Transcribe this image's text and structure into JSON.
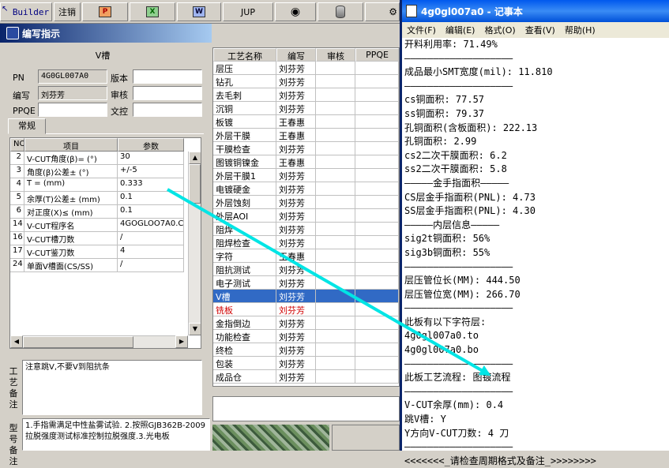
{
  "toolbar": {
    "builder_label": "Builder",
    "logout_label": "注销",
    "jup_label": "JUP",
    "ppt_icon": "P",
    "excel_icon": "X",
    "word_icon": "W"
  },
  "window": {
    "title": "编写指示"
  },
  "header": {
    "section_title": "V槽",
    "pn_label": "PN",
    "pn_value": "4G0GL007A0",
    "version_label": "版本",
    "version_value": "",
    "author_label": "编写",
    "author_value": "刘芬芳",
    "review_label": "审核",
    "review_value": "",
    "ppqe_label": "PPQE",
    "ppqe_value": "",
    "control_label": "文控",
    "control_value": ""
  },
  "tab": {
    "label": "常规"
  },
  "param_grid": {
    "headers": [
      "NO",
      "项目",
      "参数"
    ],
    "rows": [
      [
        "2",
        "V-CUT角度(β)= (°)",
        "30"
      ],
      [
        "3",
        "角度(β)公差± (°)",
        "+/-5"
      ],
      [
        "4",
        "T =  (mm)",
        "0.333"
      ],
      [
        "5",
        "余厚(T)公差± (mm)",
        "0.1"
      ],
      [
        "6",
        "对正度(X)≤ (mm)",
        "0.1"
      ],
      [
        "14",
        "V-CUT程序名",
        "4GOGLOO7A0.CS"
      ],
      [
        "16",
        "V-CUT槽刀数",
        "/"
      ],
      [
        "17",
        "V-CUT鉴刀数",
        "4"
      ],
      [
        "24",
        "单面V槽面(CS/SS)",
        "/"
      ]
    ]
  },
  "notes": {
    "process_label": "工艺备注",
    "process_text": "注意跳V,不要V到阻抗条",
    "model_label": "型号备注",
    "model_text": "1.手指需满足中性盐雾试验. 2.按照GJB362B-2009拉脱强度测试标准控制拉脱强度.3.光电板"
  },
  "process_list": {
    "headers": [
      "工艺名称",
      "编写",
      "审核",
      "PPQE"
    ],
    "rows": [
      [
        "层压",
        "刘芬芳"
      ],
      [
        "钻孔",
        "刘芬芳"
      ],
      [
        "去毛刺",
        "刘芬芳"
      ],
      [
        "沉铜",
        "刘芬芳"
      ],
      [
        "板镀",
        "王春惠"
      ],
      [
        "外层干膜",
        "王春惠"
      ],
      [
        "干膜检查",
        "刘芬芳"
      ],
      [
        "图镀铜镍金",
        "王春惠"
      ],
      [
        "外层干膜1",
        "刘芬芳"
      ],
      [
        "电镀硬金",
        "刘芬芳"
      ],
      [
        "外层蚀刻",
        "刘芬芳"
      ],
      [
        "外层AOI",
        "刘芬芳"
      ],
      [
        "阻焊",
        "刘芬芳"
      ],
      [
        "阻焊检查",
        "刘芬芳"
      ],
      [
        "字符",
        "王春惠"
      ],
      [
        "阻抗测试",
        "刘芬芳"
      ],
      [
        "电子测试",
        "刘芬芳"
      ],
      [
        "V槽",
        "刘芬芳"
      ],
      [
        "铣板",
        "刘芬芳"
      ],
      [
        "金指倒边",
        "刘芬芳"
      ],
      [
        "功能检查",
        "刘芬芳"
      ],
      [
        "终检",
        "刘芬芳"
      ],
      [
        "包装",
        "刘芬芳"
      ],
      [
        "成品仓",
        "刘芬芳"
      ]
    ],
    "selected_index": 17,
    "red_index": 18
  },
  "notepad": {
    "title": "4g0gl007a0 - 记事本",
    "menu": [
      "文件(F)",
      "编辑(E)",
      "格式(O)",
      "查看(V)",
      "帮助(H)"
    ],
    "lines": [
      "开料利用率: 71.49%",
      "———————————————————",
      "成品最小SMT宽度(mil): 11.810",
      "———————————————————",
      "cs铜面积: 77.57",
      "ss铜面积: 79.37",
      "孔铜面积(含板面积): 222.13",
      "孔铜面积: 2.99",
      "cs2二次干膜面积: 6.2",
      "ss2二次干膜面积: 5.8",
      "—————金手指面积—————",
      "CS层金手指面积(PNL): 4.73",
      "SS层金手指面积(PNL): 4.30",
      "—————内层信息—————",
      "sig2t铜面积: 56%",
      "sig3b铜面积: 55%",
      "———————————————————",
      "层压管位长(MM): 444.50",
      "层压管位宽(MM): 266.70",
      "———————————————————",
      "此板有以下字符层:",
      "4g0gl007a0.to",
      "4g0gl007a0.bo",
      "———————————————————",
      "此板工艺流程: 图镀流程",
      "———————————————————",
      "V-CUT余厚(mm): 0.4",
      "跳V槽: Y",
      "Y方向V-CUT刀数: 4 刀",
      "———————————————————",
      "<<<<<<<_请检查周期格式及备注_>>>>>>>>"
    ]
  },
  "colors": {
    "accent": "#00e5e5",
    "selection": "#316ac5",
    "titlebar": "#0058ee"
  }
}
